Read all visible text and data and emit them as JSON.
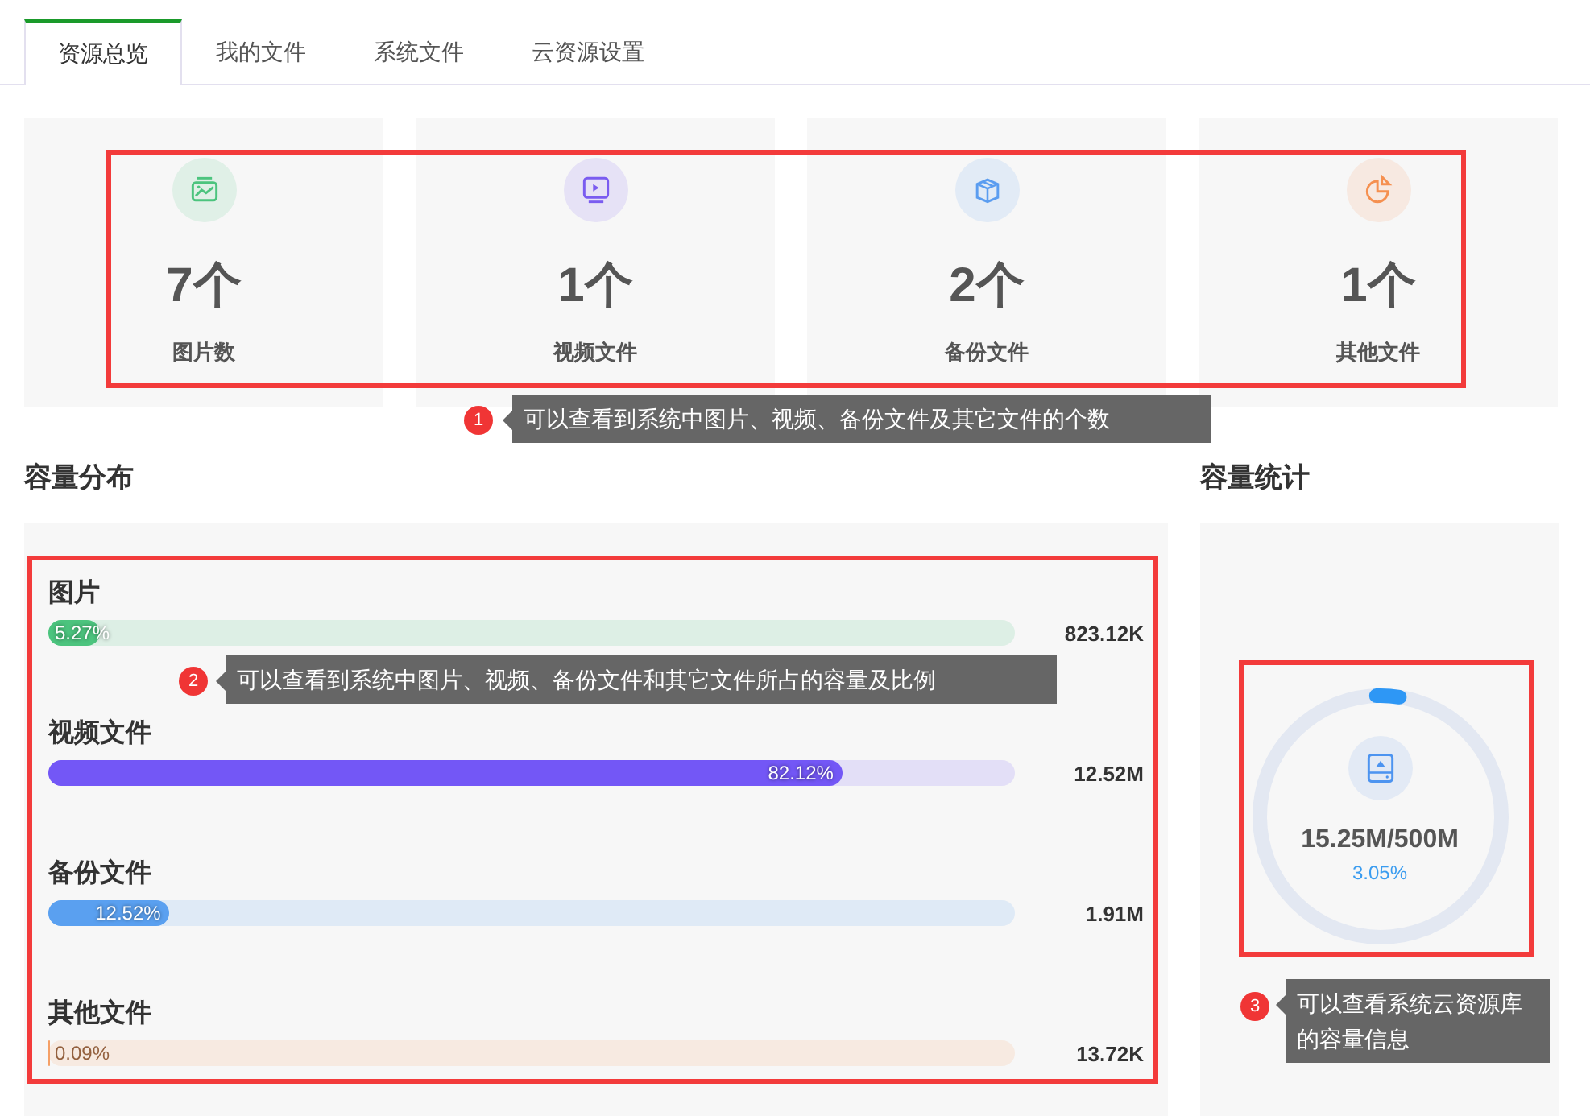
{
  "tabs": [
    {
      "label": "资源总览",
      "selected": true
    },
    {
      "label": "我的文件",
      "selected": false
    },
    {
      "label": "系统文件",
      "selected": false
    },
    {
      "label": "云资源设置",
      "selected": false
    }
  ],
  "stats": [
    {
      "kind": "image",
      "color": "#4cc47e",
      "count": "7个",
      "label": "图片数"
    },
    {
      "kind": "video",
      "color": "#7a5cf0",
      "count": "1个",
      "label": "视频文件"
    },
    {
      "kind": "backup",
      "color": "#5b9df0",
      "count": "2个",
      "label": "备份文件"
    },
    {
      "kind": "other",
      "color": "#f59050",
      "count": "1个",
      "label": "其他文件"
    }
  ],
  "distribution": {
    "title": "容量分布",
    "bars": [
      {
        "name": "图片",
        "level": 0.0527,
        "percent": "5.27%",
        "size": "823.12K",
        "color": "#4cc47e"
      },
      {
        "name": "视频文件",
        "level": 0.8212,
        "percent": "82.12%",
        "size": "12.52M",
        "color": "#7357f6"
      },
      {
        "name": "备份文件",
        "level": 0.1252,
        "percent": "12.52%",
        "size": "1.91M",
        "color": "#5aa0f0"
      },
      {
        "name": "其他文件",
        "level": 0.0009,
        "percent": "0.09%",
        "size": "13.72K",
        "color": "#f5a067"
      }
    ]
  },
  "statistics": {
    "title": "容量统计",
    "level": 0.0305,
    "usage": "15.25M/500M",
    "percent": "3.05%"
  },
  "callouts": [
    {
      "number": "1",
      "text": "可以查看到系统中图片、视频、备份文件及其它文件的个数"
    },
    {
      "number": "2",
      "text": "可以查看到系统中图片、视频、备份文件和其它文件所占的容量及比例"
    },
    {
      "number": "3",
      "text": "可以查看系统云资源库的容量信息"
    }
  ]
}
